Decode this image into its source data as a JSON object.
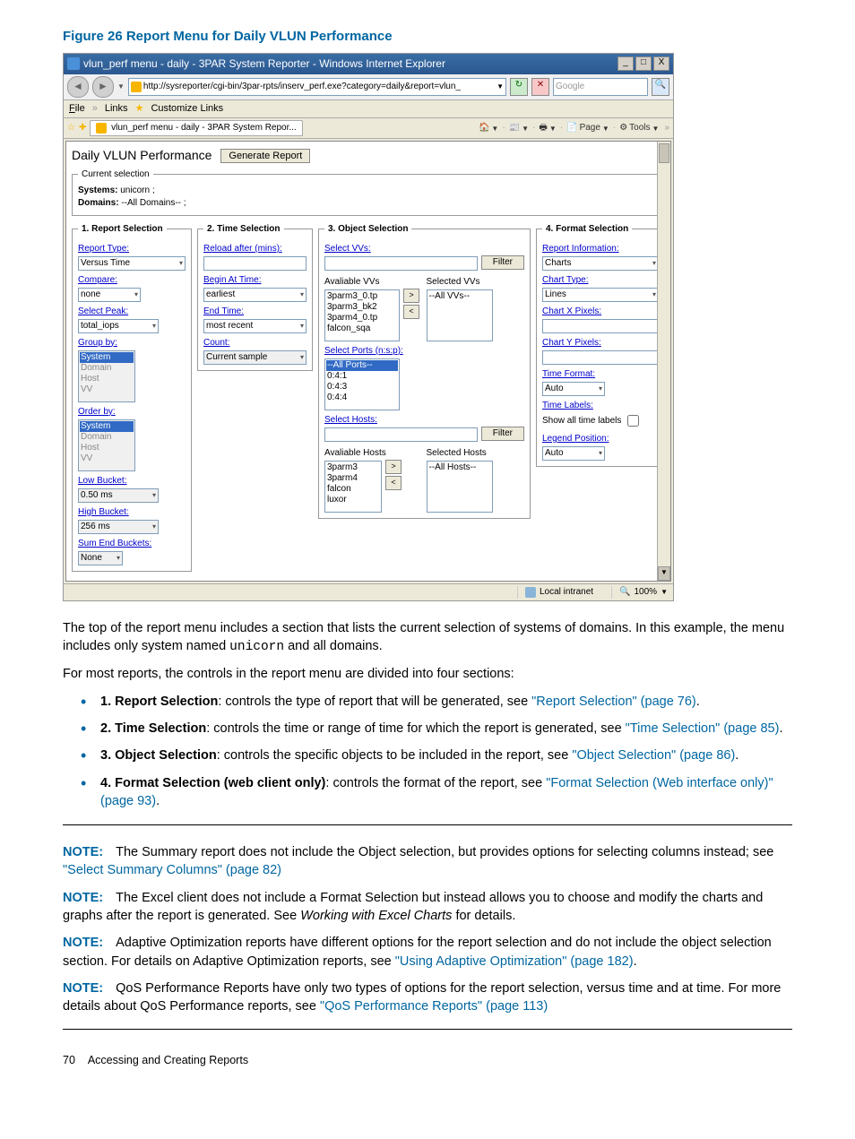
{
  "figure": {
    "title": "Figure 26 Report Menu for Daily VLUN Performance"
  },
  "window": {
    "title": "vlun_perf menu - daily - 3PAR System Reporter - Windows Internet Explorer",
    "url": "http://sysreporter/cgi-bin/3par-rpts/inserv_perf.exe?category=daily&report=vlun_",
    "search_placeholder": "Google",
    "menu_file": "File",
    "menu_links": "Links",
    "menu_customize": "Customize Links",
    "tab_label": "vlun_perf menu - daily - 3PAR System Repor...",
    "toolbar_page": "Page",
    "toolbar_tools": "Tools",
    "status_zone": "Local intranet",
    "status_zoom": "100%"
  },
  "report": {
    "page_title": "Daily VLUN Performance",
    "generate_btn": "Generate Report",
    "current_selection_legend": "Current selection",
    "systems_label": "Systems:",
    "systems_value": "unicorn ;",
    "domains_label": "Domains:",
    "domains_value": "--All Domains-- ;"
  },
  "sections": {
    "s1": {
      "legend": "1. Report Selection",
      "report_type_label": "Report Type:",
      "report_type_value": "Versus Time",
      "compare_label": "Compare:",
      "compare_value": "none",
      "select_peak_label": "Select Peak:",
      "select_peak_value": "total_iops",
      "group_by_label": "Group by:",
      "group_opts": [
        "System",
        "Domain",
        "Host",
        "VV"
      ],
      "order_by_label": "Order by:",
      "order_opts": [
        "System",
        "Domain",
        "Host",
        "VV"
      ],
      "low_bucket_label": "Low Bucket:",
      "low_bucket_value": "0.50 ms",
      "high_bucket_label": "High Bucket:",
      "high_bucket_value": "256 ms",
      "sum_end_label": "Sum End Buckets:",
      "sum_end_value": "None"
    },
    "s2": {
      "legend": "2. Time Selection",
      "reload_label": "Reload after (mins):",
      "begin_label": "Begin At Time:",
      "begin_value": "earliest",
      "end_label": "End Time:",
      "end_value": "most recent",
      "count_label": "Count:",
      "count_value": "Current sample"
    },
    "s3": {
      "legend": "3. Object Selection",
      "select_vvs_label": "Select VVs:",
      "filter_btn": "Filter",
      "avail_vvs": "Avaliable VVs",
      "sel_vvs": "Selected VVs",
      "all_vvs": "--All VVs--",
      "vv_items": [
        "3parm3_0.tp",
        "3parm3_bk2",
        "3parm4_0.tp",
        "falcon_sqa"
      ],
      "ports_label": "Select Ports (n:s:p):",
      "port_items": [
        "--All Ports--",
        "0:4:1",
        "0:4:3",
        "0:4:4"
      ],
      "hosts_label": "Select Hosts:",
      "avail_hosts": "Avaliable Hosts",
      "sel_hosts": "Selected Hosts",
      "all_hosts": "--All Hosts--",
      "host_items": [
        "3parm3",
        "3parm4",
        "falcon",
        "luxor"
      ]
    },
    "s4": {
      "legend": "4. Format Selection",
      "report_info_label": "Report Information:",
      "report_info_value": "Charts",
      "chart_type_label": "Chart Type:",
      "chart_type_value": "Lines",
      "chart_x_label": "Chart X Pixels:",
      "chart_y_label": "Chart Y Pixels:",
      "time_format_label": "Time Format:",
      "time_format_value": "Auto",
      "time_labels_label": "Time Labels:",
      "show_all_label": "Show all time labels",
      "legend_pos_label": "Legend Position:",
      "legend_pos_value": "Auto"
    }
  },
  "doc": {
    "p1a": "The top of the report menu includes a section that lists the current selection of systems of domains. In this example, the menu includes only system named ",
    "p1_code": "unicorn",
    "p1b": " and all domains.",
    "p2": "For most reports, the controls in the report menu are divided into four sections:",
    "b1_strong": "1. Report Selection",
    "b1_text": ": controls the type of report that will be generated, see ",
    "b1_link": "\"Report Selection\" (page 76)",
    "b2_strong": "2. Time Selection",
    "b2_text": ": controls the time or range of time for which the report is generated, see ",
    "b2_link": "\"Time Selection\" (page 85)",
    "b3_strong": "3. Object Selection",
    "b3_text": ": controls the specific objects to be included in the report, see ",
    "b3_link": "\"Object Selection\" (page 86)",
    "b4_strong": "4. Format Selection (web client only)",
    "b4_text": ": controls the format of the report, see ",
    "b4_link": "\"Format Selection (Web interface only)\" (page 93)",
    "note_label": "NOTE:",
    "n1a": "The Summary report does not include the Object selection, but provides options for selecting columns instead; see ",
    "n1_link": "\"Select Summary Columns\" (page 82)",
    "n2a": "The Excel client does not include a Format Selection but instead allows you to choose and modify the charts and graphs after the report is generated. See ",
    "n2_em": "Working with Excel Charts",
    "n2b": " for details.",
    "n3a": "Adaptive Optimization reports have different options for the report selection and do not include the object selection section. For details on Adaptive Optimization reports, see ",
    "n3_link": "\"Using Adaptive Optimization\" (page 182)",
    "n4a": "QoS Performance Reports have only two types of options for the report selection, versus time and at time. For more details about QoS Performance reports, see ",
    "n4_link": "\"QoS Performance Reports\" (page 113)",
    "page_num": "70",
    "footer_text": "Accessing and Creating Reports"
  }
}
